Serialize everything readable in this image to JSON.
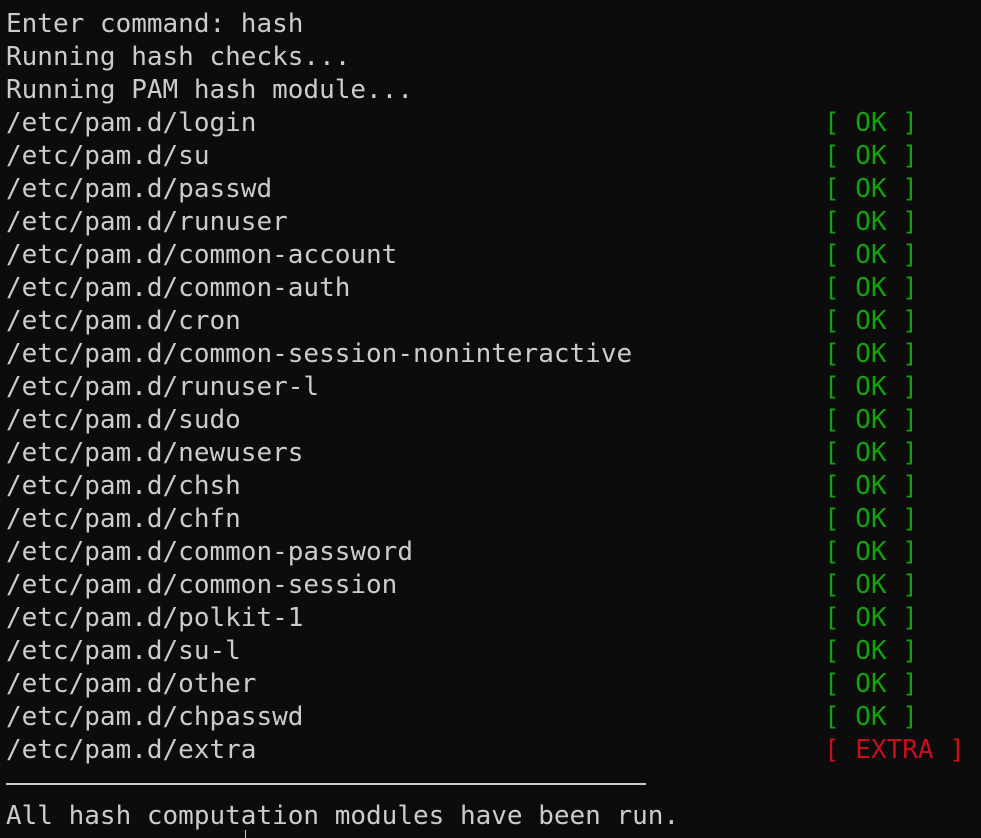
{
  "terminal": {
    "prompt_line": "Enter command: hash",
    "running_checks": "Running hash checks...",
    "running_module": "Running PAM hash module...",
    "results": [
      {
        "path": "/etc/pam.d/login",
        "status": "[ OK ]",
        "state": "ok"
      },
      {
        "path": "/etc/pam.d/su",
        "status": "[ OK ]",
        "state": "ok"
      },
      {
        "path": "/etc/pam.d/passwd",
        "status": "[ OK ]",
        "state": "ok"
      },
      {
        "path": "/etc/pam.d/runuser",
        "status": "[ OK ]",
        "state": "ok"
      },
      {
        "path": "/etc/pam.d/common-account",
        "status": "[ OK ]",
        "state": "ok"
      },
      {
        "path": "/etc/pam.d/common-auth",
        "status": "[ OK ]",
        "state": "ok"
      },
      {
        "path": "/etc/pam.d/cron",
        "status": "[ OK ]",
        "state": "ok"
      },
      {
        "path": "/etc/pam.d/common-session-noninteractive",
        "status": "[ OK ]",
        "state": "ok"
      },
      {
        "path": "/etc/pam.d/runuser-l",
        "status": "[ OK ]",
        "state": "ok"
      },
      {
        "path": "/etc/pam.d/sudo",
        "status": "[ OK ]",
        "state": "ok"
      },
      {
        "path": "/etc/pam.d/newusers",
        "status": "[ OK ]",
        "state": "ok"
      },
      {
        "path": "/etc/pam.d/chsh",
        "status": "[ OK ]",
        "state": "ok"
      },
      {
        "path": "/etc/pam.d/chfn",
        "status": "[ OK ]",
        "state": "ok"
      },
      {
        "path": "/etc/pam.d/common-password",
        "status": "[ OK ]",
        "state": "ok"
      },
      {
        "path": "/etc/pam.d/common-session",
        "status": "[ OK ]",
        "state": "ok"
      },
      {
        "path": "/etc/pam.d/polkit-1",
        "status": "[ OK ]",
        "state": "ok"
      },
      {
        "path": "/etc/pam.d/su-l",
        "status": "[ OK ]",
        "state": "ok"
      },
      {
        "path": "/etc/pam.d/other",
        "status": "[ OK ]",
        "state": "ok"
      },
      {
        "path": "/etc/pam.d/chpasswd",
        "status": "[ OK ]",
        "state": "ok"
      },
      {
        "path": "/etc/pam.d/extra",
        "status": "[ EXTRA ]",
        "state": "extra"
      }
    ],
    "summary": "All hash computation modules have been run."
  },
  "colors": {
    "background": "#0c0c0c",
    "text": "#cccccc",
    "ok": "#13a10e",
    "extra": "#c50f1f"
  }
}
